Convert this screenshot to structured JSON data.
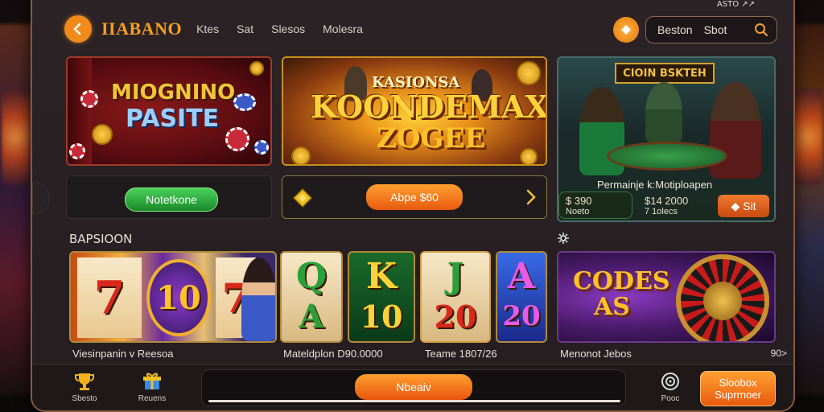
{
  "status_bar": {
    "text": "ASTO ↗↗"
  },
  "header": {
    "logo": "IIABANO",
    "nav": [
      "Ktes",
      "Sat",
      "Slesos",
      "Molesra"
    ],
    "search": {
      "label1": "Beston",
      "label2": "Sbot"
    }
  },
  "banners": {
    "left": {
      "line1": "MIOGNINO",
      "line2": "PASITE"
    },
    "center": {
      "line1": "KASIONSA",
      "line2": "KOONDEMAX",
      "line3": "ZOGEE"
    },
    "right": {
      "title": "CIOIN BSKTEH",
      "subtitle": "Permainje k:Motiploapen",
      "stat1": {
        "value": "$ 390",
        "label": "Noeto"
      },
      "stat2": {
        "value": "$14 2000",
        "label": "7 1olecs"
      },
      "button": "Sit"
    }
  },
  "actions": {
    "left_button": "Notetkone",
    "center_button": "Abpe $60"
  },
  "section": {
    "title": "BAPSIOON"
  },
  "games": {
    "big": {
      "reels": [
        "7",
        "10",
        "7"
      ],
      "caption": "Viesinpanin v Reesoa"
    },
    "small": [
      {
        "symbol": "Q",
        "value": "A"
      },
      {
        "symbol": "K",
        "value": "10"
      },
      {
        "symbol": "J",
        "value": "20"
      },
      {
        "symbol": "A",
        "value": "20"
      }
    ],
    "caption_mid": "Mateldplon D90.0000",
    "caption_right": "Teame 1807/26",
    "roulette": {
      "line1": "CODES",
      "line2": "AS",
      "caption": "Menonot Jebos",
      "price": "90>"
    }
  },
  "bottom": {
    "item1": "Sbesto",
    "item2": "Reuens",
    "deposit": "Nbeaiv",
    "item3": "Pooc",
    "cta_line1": "Sloobox",
    "cta_line2": "Suprrnoer"
  }
}
